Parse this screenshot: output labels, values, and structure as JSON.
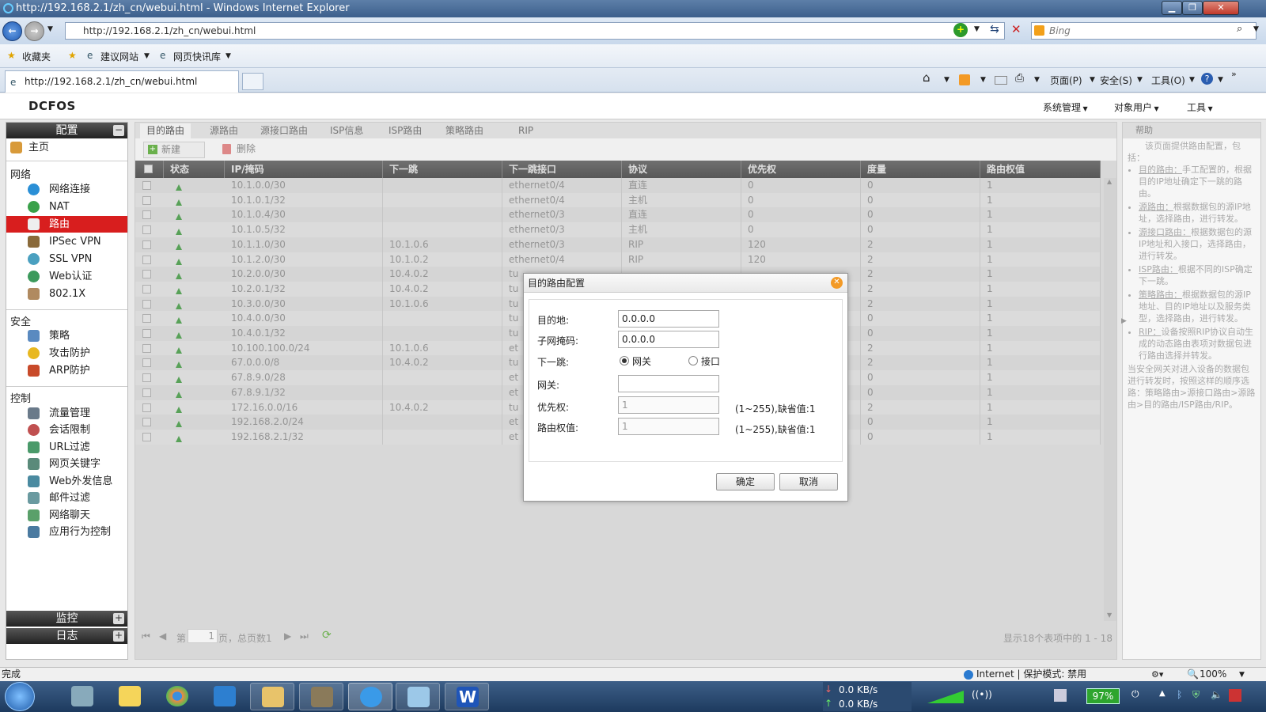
{
  "browser": {
    "title": "http://192.168.2.1/zh_cn/webui.html - Windows Internet Explorer",
    "url": "http://192.168.2.1/zh_cn/webui.html",
    "search_placeholder": "Bing",
    "favorites": {
      "star": "收藏夹",
      "suggested": "建议网站",
      "slices": "网页快讯库"
    },
    "tab_title": "http://192.168.2.1/zh_cn/webui.html",
    "commands": {
      "page": "页面(P)",
      "safety": "安全(S)",
      "tools": "工具(O)"
    },
    "status": "完成",
    "zone": "Internet | 保护模式: 禁用",
    "zoom": "100%"
  },
  "app": {
    "logo": "DCFOS",
    "top_menu": [
      "系统管理",
      "对象用户",
      "工具"
    ],
    "sidebar": {
      "config_header": "配置",
      "home": "主页",
      "sections": [
        {
          "title": "网络",
          "items": [
            "网络连接",
            "NAT",
            "路由",
            "IPSec VPN",
            "SSL VPN",
            "Web认证",
            "802.1X"
          ]
        },
        {
          "title": "安全",
          "items": [
            "策略",
            "攻击防护",
            "ARP防护"
          ]
        },
        {
          "title": "控制",
          "items": [
            "流量管理",
            "会话限制",
            "URL过滤",
            "网页关键字",
            "Web外发信息",
            "邮件过滤",
            "网络聊天",
            "应用行为控制"
          ]
        }
      ],
      "monitor_header": "监控",
      "log_header": "日志"
    },
    "tabs": [
      "目的路由",
      "源路由",
      "源接口路由",
      "ISP信息",
      "ISP路由",
      "策略路由",
      "RIP"
    ],
    "toolbar": {
      "new": "新建",
      "delete": "删除"
    },
    "columns": [
      "状态",
      "IP/掩码",
      "下一跳",
      "下一跳接口",
      "协议",
      "优先权",
      "度量",
      "路由权值"
    ],
    "rows": [
      [
        "10.1.0.0/30",
        "",
        "ethernet0/4",
        "直连",
        "0",
        "0",
        "1"
      ],
      [
        "10.1.0.1/32",
        "",
        "ethernet0/4",
        "主机",
        "0",
        "0",
        "1"
      ],
      [
        "10.1.0.4/30",
        "",
        "ethernet0/3",
        "直连",
        "0",
        "0",
        "1"
      ],
      [
        "10.1.0.5/32",
        "",
        "ethernet0/3",
        "主机",
        "0",
        "0",
        "1"
      ],
      [
        "10.1.1.0/30",
        "10.1.0.6",
        "ethernet0/3",
        "RIP",
        "120",
        "2",
        "1"
      ],
      [
        "10.1.2.0/30",
        "10.1.0.2",
        "ethernet0/4",
        "RIP",
        "120",
        "2",
        "1"
      ],
      [
        "10.2.0.0/30",
        "10.4.0.2",
        "tu",
        "",
        "",
        "2",
        "1"
      ],
      [
        "10.2.0.1/32",
        "10.4.0.2",
        "tu",
        "",
        "",
        "2",
        "1"
      ],
      [
        "10.3.0.0/30",
        "10.1.0.6",
        "tu",
        "",
        "",
        "2",
        "1"
      ],
      [
        "10.4.0.0/30",
        "",
        "tu",
        "",
        "",
        "0",
        "1"
      ],
      [
        "10.4.0.1/32",
        "",
        "tu",
        "",
        "",
        "0",
        "1"
      ],
      [
        "10.100.100.0/24",
        "10.1.0.6",
        "et",
        "",
        "",
        "2",
        "1"
      ],
      [
        "67.0.0.0/8",
        "10.4.0.2",
        "tu",
        "",
        "",
        "2",
        "1"
      ],
      [
        "67.8.9.0/28",
        "",
        "et",
        "",
        "",
        "0",
        "1"
      ],
      [
        "67.8.9.1/32",
        "",
        "et",
        "",
        "",
        "0",
        "1"
      ],
      [
        "172.16.0.0/16",
        "10.4.0.2",
        "tu",
        "",
        "",
        "2",
        "1"
      ],
      [
        "192.168.2.0/24",
        "",
        "et",
        "",
        "",
        "0",
        "1"
      ],
      [
        "192.168.2.1/32",
        "",
        "et",
        "",
        "",
        "0",
        "1"
      ]
    ],
    "pager": {
      "page_prefix": "第",
      "page_value": "1",
      "page_suffix": "页，总页数1",
      "summary": "显示18个表项中的 1 - 18"
    },
    "help": {
      "title": "帮助",
      "intro": "该页面提供路由配置，包括：",
      "items": [
        {
          "link": "目的路由：",
          "text": "手工配置的，根据目的IP地址确定下一跳的路由。"
        },
        {
          "link": "源路由：",
          "text": "根据数据包的源IP地址，选择路由，进行转发。"
        },
        {
          "link": "源接口路由：",
          "text": "根据数据包的源IP地址和入接口，选择路由，进行转发。"
        },
        {
          "link": "ISP路由：",
          "text": "根据不同的ISP确定下一跳。"
        },
        {
          "link": "策略路由：",
          "text": "根据数据包的源IP地址、目的IP地址以及服务类型，选择路由，进行转发。"
        },
        {
          "link": "RIP：",
          "text": "设备按照RIP协议自动生成的动态路由表项对数据包进行路由选择并转发。"
        }
      ],
      "footer": "当安全网关对进入设备的数据包进行转发时，按照这样的顺序选路：策略路由>源接口路由>源路由>目的路由/ISP路由/RIP。"
    }
  },
  "dialog": {
    "title": "目的路由配置",
    "dest_label": "目的地:",
    "dest_value": "0.0.0.0",
    "mask_label": "子网掩码:",
    "mask_value": "0.0.0.0",
    "nexthop_label": "下一跳:",
    "opt_gateway": "网关",
    "opt_interface": "接口",
    "gateway_label": "网关:",
    "gateway_value": "",
    "priority_label": "优先权:",
    "priority_value": "1",
    "priority_hint": "(1~255),缺省值:1",
    "weight_label": "路由权值:",
    "weight_value": "1",
    "weight_hint": "(1~255),缺省值:1",
    "ok": "确定",
    "cancel": "取消"
  },
  "taskbar": {
    "down": "0.0 KB/s",
    "up": "0.0 KB/s",
    "battery": "97%"
  }
}
